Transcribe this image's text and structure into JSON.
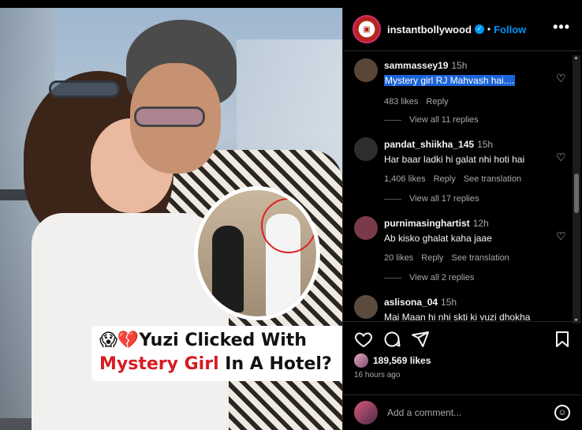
{
  "post": {
    "caption_line1": "😱💔Yuzi Clicked With",
    "caption_line2_highlight": "Mystery Girl",
    "caption_line2_rest": " In A Hotel?"
  },
  "header": {
    "username": "instantbollywood",
    "separator": "•",
    "follow_label": "Follow",
    "more_icon": "more-horizontal-icon"
  },
  "comments": [
    {
      "user": "sammassey19",
      "time": "15h",
      "text": "Mystery girl RJ Mahvash hai....",
      "likes": "483 likes",
      "reply": "Reply",
      "translate": "",
      "view_replies": "View all 11 replies",
      "avatar_color": "#5a4636",
      "selected": true
    },
    {
      "user": "pandat_shiikha_145",
      "time": "15h",
      "text": "Har baar ladki hi galat nhi hoti hai",
      "likes": "1,406 likes",
      "reply": "Reply",
      "translate": "See translation",
      "view_replies": "View all 17 replies",
      "avatar_color": "#2e2e2e",
      "selected": false
    },
    {
      "user": "purnimasinghartist",
      "time": "12h",
      "text": "Ab kisko ghalat kaha jaae",
      "likes": "20 likes",
      "reply": "Reply",
      "translate": "See translation",
      "view_replies": "View all 2 replies",
      "avatar_color": "#7a3a4a",
      "selected": false
    },
    {
      "user": "aslisona_04",
      "time": "15h",
      "text": "Mai Maan hi nhi skti ki yuzi dhokha",
      "likes": "",
      "reply": "",
      "translate": "",
      "view_replies": "",
      "avatar_color": "#5b4b3e",
      "selected": false
    }
  ],
  "actions": {
    "like_icon": "heart-icon",
    "comment_icon": "comment-icon",
    "share_icon": "share-icon",
    "save_icon": "bookmark-icon"
  },
  "likes_count": "189,569 likes",
  "time_ago": "16 hours ago",
  "add_comment": {
    "placeholder": "Add a comment...",
    "emoji_icon": "emoji-icon"
  },
  "colors": {
    "accent": "#0095f6",
    "highlight_red": "#d81b23",
    "selection": "#1a63d8"
  }
}
